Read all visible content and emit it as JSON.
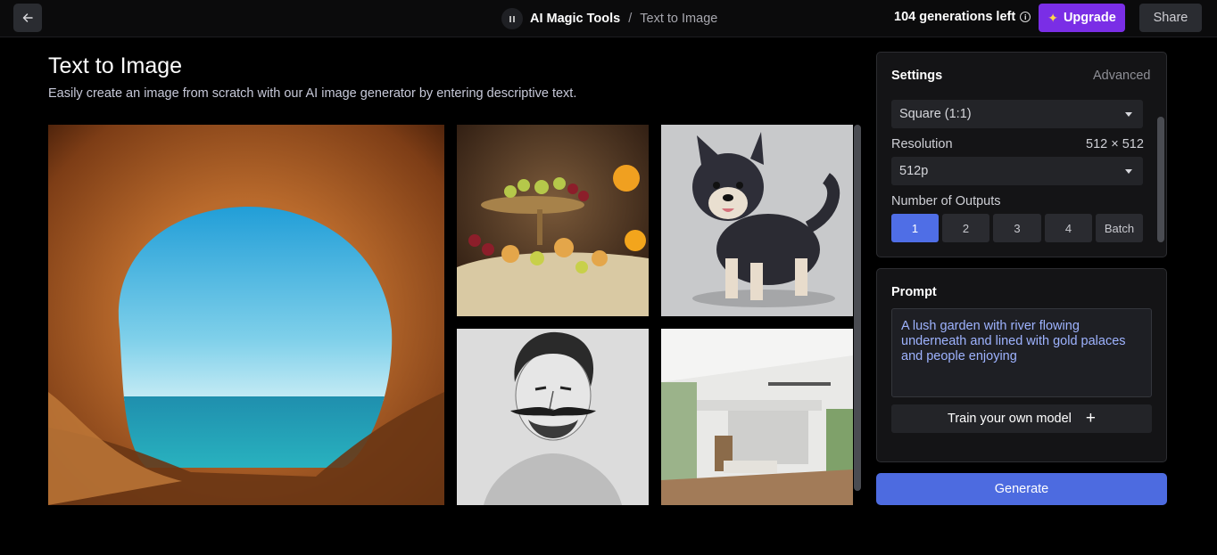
{
  "header": {
    "breadcrumb_root": "AI Magic Tools",
    "breadcrumb_sep": "/",
    "breadcrumb_current": "Text to Image",
    "generations_left": "104 generations left",
    "info_glyph": "i",
    "upgrade_label": "Upgrade",
    "share_label": "Share"
  },
  "page": {
    "title": "Text to Image",
    "subtitle": "Easily create an image from scratch with our AI image generator by entering descriptive text."
  },
  "gallery": [
    {
      "name": "cave-ocean-image",
      "icon": "image"
    },
    {
      "name": "fruit-still-life-image",
      "icon": "image"
    },
    {
      "name": "husky-puppy-image",
      "icon": "image"
    },
    {
      "name": "mustache-portrait-image",
      "icon": "image"
    },
    {
      "name": "modern-interior-image",
      "icon": "image"
    }
  ],
  "settings": {
    "title": "Settings",
    "advanced_label": "Advanced",
    "aspect_ratio": "Square (1:1)",
    "resolution_label": "Resolution",
    "resolution_value": "512 × 512",
    "resolution_select": "512p",
    "outputs_label": "Number of Outputs",
    "outputs": [
      "1",
      "2",
      "3",
      "4",
      "Batch"
    ],
    "selected_output": "1"
  },
  "prompt": {
    "title": "Prompt",
    "text": "A lush garden with river flowing underneath and lined with gold palaces and people enjoying",
    "train_label": "Train your own model",
    "train_icon": "+"
  },
  "generate_label": "Generate",
  "colors": {
    "accent": "#4d6be0",
    "upgrade": "#7a2ee6",
    "prompt_text": "#9eb3ff"
  }
}
